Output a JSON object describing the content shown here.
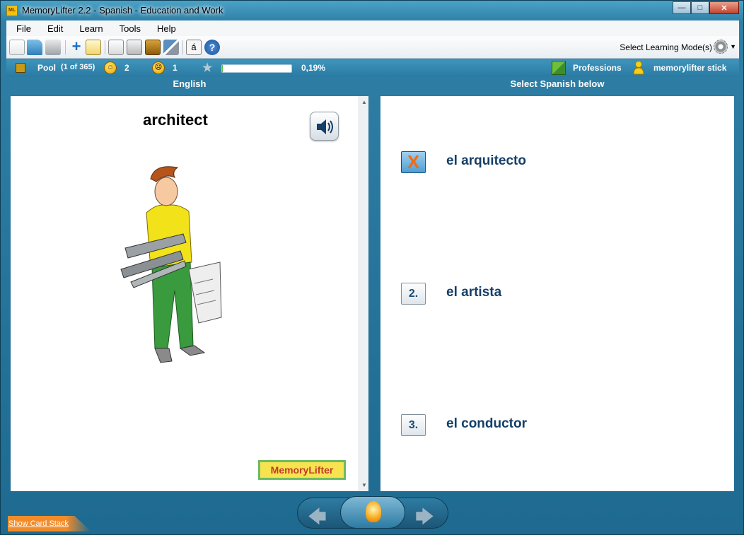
{
  "window": {
    "title": "MemoryLifter 2.2 - Spanish - Education and Work",
    "app_icon_text": "ML",
    "buttons": {
      "minimize": "—",
      "maximize": "□",
      "close": "✕"
    }
  },
  "menu": [
    "File",
    "Edit",
    "Learn",
    "Tools",
    "Help"
  ],
  "toolbar": {
    "icons": [
      "new-icon",
      "open-icon",
      "print-icon",
      "add-icon",
      "edit-icon",
      "presentation-icon",
      "card-style-icon",
      "pool-icon",
      "settings-tools-icon",
      "special-char-icon",
      "help-icon"
    ],
    "special_char": "á",
    "help_char": "?",
    "mode_label": "Select Learning Mode(s)"
  },
  "status": {
    "pool_label": "Pool",
    "pool_count": "(1 of 365)",
    "happy_count": "2",
    "sad_count": "1",
    "progress_percent": 0.19,
    "progress_text": "0,19%",
    "chapter": "Professions",
    "user": "memorylifter stick"
  },
  "question": {
    "header": "English",
    "word": "architect",
    "logo_text": "MemoryLifter"
  },
  "answers": {
    "header": "Select Spanish below",
    "options": [
      {
        "key": "X",
        "text": "el arquitecto"
      },
      {
        "key": "2.",
        "text": "el artista"
      },
      {
        "key": "3.",
        "text": "el conductor"
      }
    ]
  },
  "navigation": {
    "back": "🡄",
    "forward": "🡆",
    "show_card_stack": "Show Card Stack"
  }
}
